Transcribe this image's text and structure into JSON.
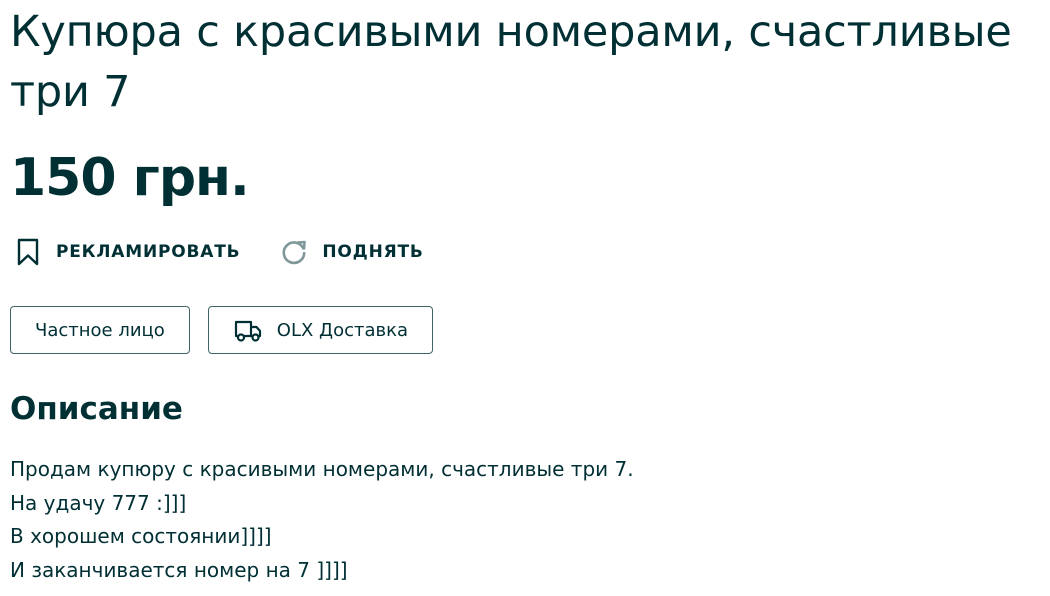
{
  "listing": {
    "title": "Купюра с красивыми номерами, счастливые три 7",
    "price": "150 грн."
  },
  "actions": {
    "promote": {
      "label": "РЕКЛАМИРОВАТЬ",
      "icon": "bookmark-icon"
    },
    "raise": {
      "label": "ПОДНЯТЬ",
      "icon": "refresh-icon"
    }
  },
  "tags": {
    "seller_type": {
      "label": "Частное лицо"
    },
    "delivery": {
      "label": "OLX Доставка",
      "icon": "delivery-truck-icon"
    }
  },
  "description": {
    "heading": "Описание",
    "lines": [
      "Продам купюру с красивыми номерами, счастливые три 7.",
      "На удачу 777 :]]]",
      "В хорошем состоянии]]]]",
      "И заканчивается номер на 7 ]]]]"
    ]
  },
  "colors": {
    "text": "#002f34",
    "border": "#406367",
    "icon_muted": "#7f9799"
  }
}
